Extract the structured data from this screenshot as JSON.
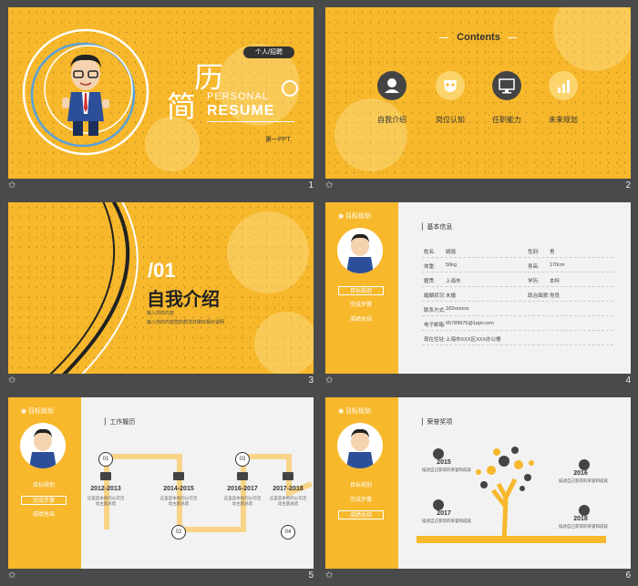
{
  "colors": {
    "accent": "#f7b82c",
    "dark": "#333333",
    "background": "#4a4a4a"
  },
  "footers": [
    {
      "icon": "star-icon",
      "num": "1"
    },
    {
      "icon": "star-icon",
      "num": "2"
    },
    {
      "icon": "star-icon",
      "num": "3"
    },
    {
      "icon": "star-icon",
      "num": "4"
    },
    {
      "icon": "star-icon",
      "num": "5"
    },
    {
      "icon": "star-icon",
      "num": "6"
    }
  ],
  "slide1": {
    "badge": "个人/招聘",
    "title_a": "简",
    "title_b": "历",
    "en1": "PERSONAL",
    "en2": "RESUME",
    "sub": "第一PPT"
  },
  "slide2": {
    "title": "Contents",
    "items": [
      "自我介绍",
      "岗位认知",
      "任职能力",
      "未来规划"
    ]
  },
  "slide3": {
    "num": "/01",
    "title": "自我介绍",
    "line1": "输入你的内容",
    "line2": "输入你的内容您的想法并做好相对说明"
  },
  "sidebar": {
    "title": "目标规划",
    "items": [
      "目标规划",
      "完成步骤",
      "成绩总结"
    ]
  },
  "slide4": {
    "section": "基本信息",
    "rows": [
      {
        "k1": "姓名:",
        "v1": "姚瑶",
        "k2": "性别:",
        "v2": "男"
      },
      {
        "k1": "体重:",
        "v1": "50kg",
        "k2": "身高:",
        "v2": "170cm"
      },
      {
        "k1": "籍贯:",
        "v1": "上海市",
        "k2": "学历:",
        "v2": "本科"
      },
      {
        "k1": "婚姻状况:",
        "v1": "未婚",
        "k2": "政治面貌:",
        "v2": "党员"
      },
      {
        "k1": "联系方式:",
        "v1": "182xxxxxx",
        "k2": "",
        "v2": ""
      },
      {
        "k1": "电子邮箱:",
        "v1": "65789976@1ppt.com",
        "k2": "",
        "v2": ""
      },
      {
        "k1": "现在住址:",
        "v1": "上海市XXX区XXX办公楼",
        "k2": "",
        "v2": ""
      }
    ]
  },
  "slide5": {
    "section": "工作履历",
    "steps": [
      {
        "n": "01",
        "year": "2012-2013",
        "text": "这里是本地的公司活动主题总结"
      },
      {
        "n": "02",
        "year": "2014-2015",
        "text": "这里是本地的公司活动主题总结"
      },
      {
        "n": "03",
        "year": "2016-2017",
        "text": "这里是本地的公司活动主题总结"
      },
      {
        "n": "04",
        "year": "2017-2018",
        "text": "这里是本地的公司活动主题总结"
      }
    ]
  },
  "slide6": {
    "section": "荣誉奖项",
    "awards": [
      {
        "year": "2015",
        "text": "描述自己获得的荣誉和成就"
      },
      {
        "year": "2016",
        "text": "描述自己获得的荣誉和成就"
      },
      {
        "year": "2017",
        "text": "描述自己获得的荣誉和成就"
      },
      {
        "year": "2018",
        "text": "描述自己获得的荣誉和成就"
      }
    ]
  }
}
